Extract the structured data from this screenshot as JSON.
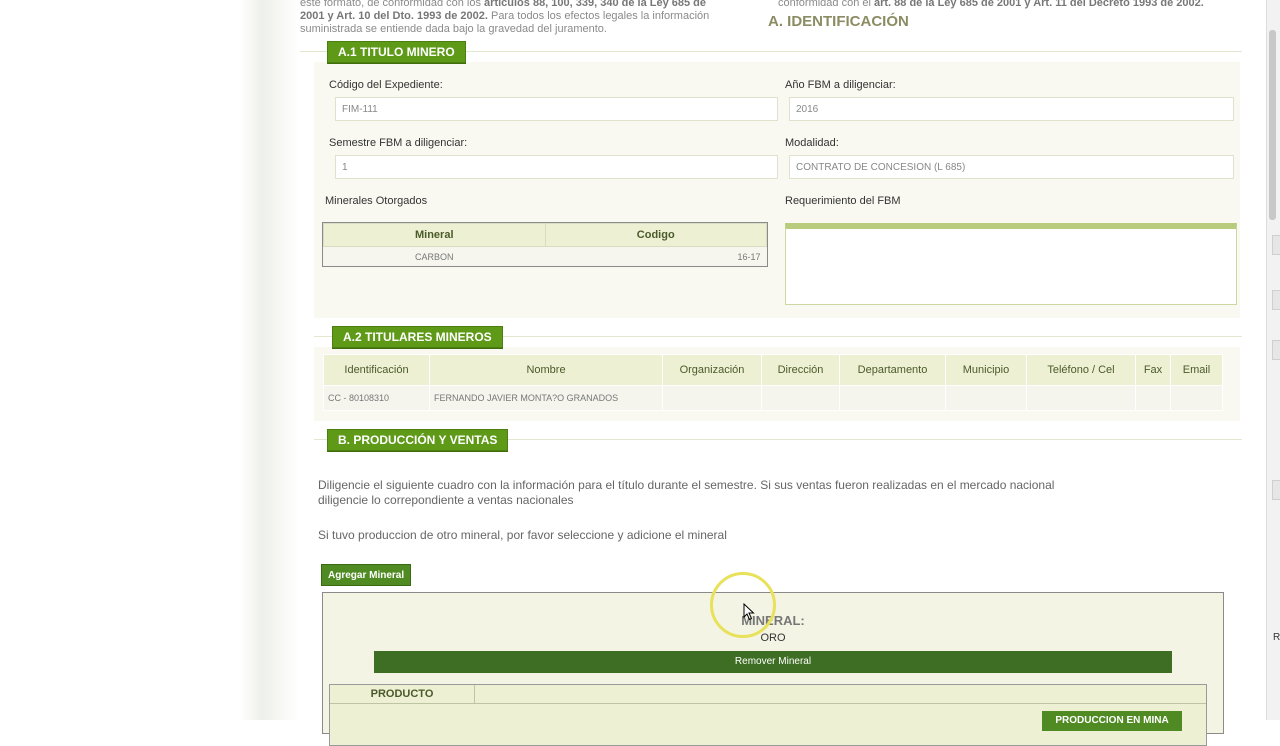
{
  "intro": {
    "left_line1_pre": "este formato, de conformidad con los ",
    "left_line1_bold": "artículos 88, 100, 339, 340 de la Ley 685 de",
    "left_line2_bold": "2001 y Art. 10 del Dto. 1993 de 2002.",
    "left_line2_post": " Para todos los efectos legales la información",
    "left_line3": "suministrada se entiende dada bajo la gravedad del juramento.",
    "right_line1_pre": "conformidad con el ",
    "right_line1_bold": "art. 88 de la Ley 685 de 2001 y Art. 11 del Decreto 1993 de 2002."
  },
  "identificacion_title": "A. IDENTIFICACIÓN",
  "a1": {
    "tab": "A.1 TITULO MINERO",
    "codigo_label": "Código del Expediente:",
    "codigo_value": "FIM-111",
    "ano_label": "Año FBM a diligenciar:",
    "ano_value": "2016",
    "semestre_label": "Semestre FBM a diligenciar:",
    "semestre_value": "1",
    "modalidad_label": "Modalidad:",
    "modalidad_value": "CONTRATO DE CONCESION (L 685)",
    "minerales_label": "Minerales Otorgados",
    "minerales_headers": [
      "Mineral",
      "Codigo"
    ],
    "minerales_rows": [
      [
        "CARBON",
        "16-17"
      ]
    ],
    "requerimiento_label": "Requerimiento del FBM",
    "requerimiento_value": ""
  },
  "a2": {
    "tab": "A.2 TITULARES MINEROS",
    "headers": [
      "Identificación",
      "Nombre",
      "Organización",
      "Dirección",
      "Departamento",
      "Municipio",
      "Teléfono / Cel",
      "Fax",
      "Email"
    ],
    "rows": [
      [
        "CC - 80108310",
        "FERNANDO JAVIER MONTA?O GRANADOS",
        "",
        "",
        "",
        "",
        "",
        "",
        ""
      ]
    ]
  },
  "b": {
    "tab": "B. PRODUCCIÓN Y VENTAS",
    "para1_line1": "Diligencie el siguiente cuadro con la información para el título durante el semestre. Si sus ventas fueron realizadas en el mercado nacional",
    "para1_line2": "diligencie lo correpondiente a ventas nacionales",
    "para2": "Si tuvo produccion de otro mineral, por favor seleccione y adicione el mineral",
    "agregar_button": "Agregar Mineral",
    "mineral_label": "MINERAL:",
    "mineral_value": "ORO",
    "remover_button": "Remover Mineral",
    "producto_header": "PRODUCTO",
    "produccion_button": "PRODUCCION EN MINA"
  },
  "right_panel_letter": "R",
  "colors": {
    "accent_green": "#5e9a17",
    "dark_green": "#3e6e23",
    "header_bg": "#eef0d4"
  }
}
